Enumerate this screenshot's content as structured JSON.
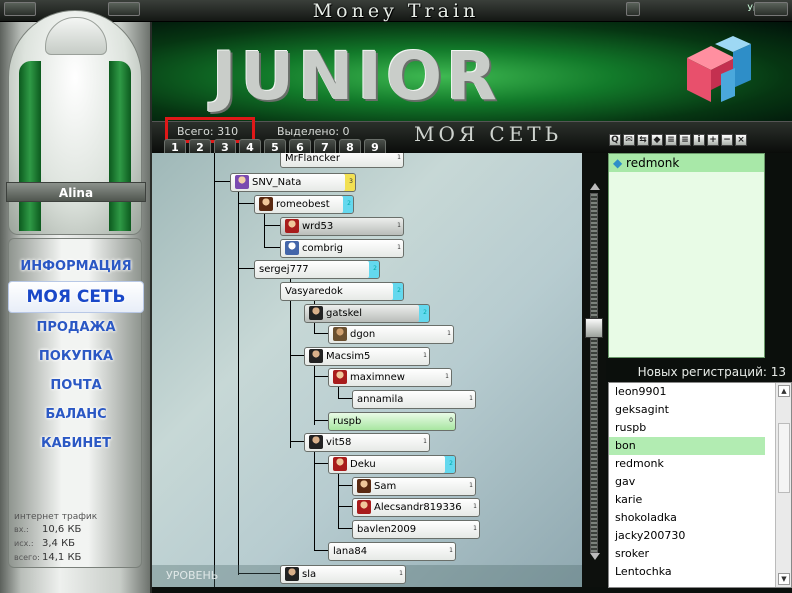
{
  "window": {
    "app_title": "Money Train",
    "lang": "Укр"
  },
  "sidebar": {
    "user_name": "Alina",
    "menu": [
      "ИНФОРМАЦИЯ",
      "МОЯ СЕТЬ",
      "ПРОДАЖА",
      "ПОКУПКА",
      "ПОЧТА",
      "БАЛАНС",
      "КАБИНЕТ"
    ],
    "active_index": 1,
    "traffic": {
      "title": "интернет трафик",
      "rows": [
        {
          "key": "вх.:",
          "val": "10,6 КБ"
        },
        {
          "key": "исх.:",
          "val": "3,4 КБ"
        },
        {
          "key": "всего:",
          "val": "14,1 КБ"
        }
      ]
    }
  },
  "banner": {
    "title": "JUNIOR"
  },
  "toolbar": {
    "total_label": "Всего:",
    "total_value": "310",
    "selected_label": "Выделено:",
    "selected_value": "0",
    "section_title": "МОЯ СЕТЬ",
    "levels": [
      "1",
      "2",
      "3",
      "4",
      "5",
      "6",
      "7",
      "8",
      "9"
    ],
    "tools": [
      "search-tool",
      "mail-tool",
      "swap-tool",
      "cube-tool",
      "list-tool",
      "list2-tool",
      "info-tool",
      "add-tool",
      "remove-tool",
      "close-tool"
    ],
    "tool_glyphs": [
      "Q",
      "✉",
      "⇆",
      "◆",
      "≡",
      "≡",
      "i",
      "+",
      "−",
      "×"
    ]
  },
  "tree": {
    "nodes": [
      {
        "id": "mrflancker",
        "label": "MrFlancker",
        "badge": "1",
        "style": "white",
        "avatar": ""
      },
      {
        "id": "snv_nata",
        "label": "SNV_Nata",
        "badge": "3",
        "style": "hl-y",
        "avatar": "purple"
      },
      {
        "id": "romeobest",
        "label": "romeobest",
        "badge": "2",
        "style": "hl-c",
        "avatar": "brown"
      },
      {
        "id": "wrd53",
        "label": "wrd53",
        "badge": "1",
        "style": "gray",
        "avatar": "red"
      },
      {
        "id": "combrig",
        "label": "combrig",
        "badge": "1",
        "style": "white",
        "avatar": "white"
      },
      {
        "id": "sergej777",
        "label": "sergej777",
        "badge": "2",
        "style": "hl-c",
        "avatar": ""
      },
      {
        "id": "vasyaredok",
        "label": "Vasyaredok",
        "badge": "2",
        "style": "hl-c",
        "avatar": ""
      },
      {
        "id": "gatskel",
        "label": "gatskel",
        "badge": "2",
        "style": "gray-c",
        "avatar": "dark"
      },
      {
        "id": "dgon",
        "label": "dgon",
        "badge": "1",
        "style": "white",
        "avatar": "tan"
      },
      {
        "id": "macsim5",
        "label": "Macsim5",
        "badge": "1",
        "style": "white",
        "avatar": "dark"
      },
      {
        "id": "maximnew",
        "label": "maximnew",
        "badge": "1",
        "style": "white",
        "avatar": "red"
      },
      {
        "id": "annamila",
        "label": "annamila",
        "badge": "1",
        "style": "white",
        "avatar": ""
      },
      {
        "id": "ruspb",
        "label": "ruspb",
        "badge": "0",
        "style": "green",
        "avatar": ""
      },
      {
        "id": "vit58",
        "label": "vit58",
        "badge": "1",
        "style": "white",
        "avatar": "dark"
      },
      {
        "id": "deku",
        "label": "Deku",
        "badge": "2",
        "style": "hl-c",
        "avatar": "red"
      },
      {
        "id": "sam",
        "label": "Sam",
        "badge": "1",
        "style": "white",
        "avatar": "brown"
      },
      {
        "id": "alecsandr",
        "label": "Alecsandr819336",
        "badge": "1",
        "style": "white",
        "avatar": "red"
      },
      {
        "id": "bavlen",
        "label": "bavlen2009",
        "badge": "1",
        "style": "white",
        "avatar": ""
      },
      {
        "id": "lana84",
        "label": "lana84",
        "badge": "1",
        "style": "white",
        "avatar": ""
      },
      {
        "id": "sla",
        "label": "sla",
        "badge": "1",
        "style": "white",
        "avatar": "dark"
      }
    ],
    "footer": "УРОВЕНЬ"
  },
  "right_panel": {
    "items": [
      {
        "label": "redmonk",
        "selected": true
      }
    ]
  },
  "registrations": {
    "title": "Новых регистраций: 13",
    "items": [
      "leon9901",
      "geksagint",
      "ruspb",
      "bon",
      "redmonk",
      "gav",
      "karie",
      "shokoladka",
      "jacky200730",
      "sroker",
      "Lentochka"
    ],
    "selected_index": 3
  }
}
